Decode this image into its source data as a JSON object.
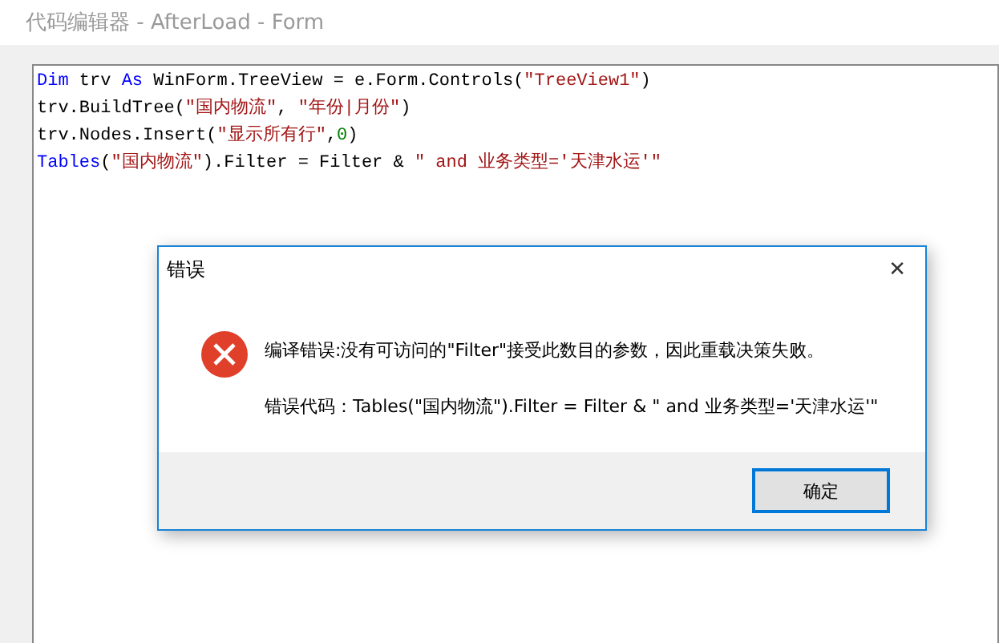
{
  "window": {
    "title": "代码编辑器 - AfterLoad - Form"
  },
  "code_lines": [
    [
      {
        "kind": "keyword",
        "text": "Dim"
      },
      {
        "kind": "plain",
        "text": " trv "
      },
      {
        "kind": "keyword",
        "text": "As"
      },
      {
        "kind": "plain",
        "text": " WinForm.TreeView = e.Form.Controls("
      },
      {
        "kind": "string",
        "text": "\"TreeView1\""
      },
      {
        "kind": "plain",
        "text": ")"
      }
    ],
    [
      {
        "kind": "plain",
        "text": "trv.BuildTree("
      },
      {
        "kind": "string",
        "text": "\"国内物流\""
      },
      {
        "kind": "plain",
        "text": ", "
      },
      {
        "kind": "string",
        "text": "\"年份|月份\""
      },
      {
        "kind": "plain",
        "text": ")"
      }
    ],
    [
      {
        "kind": "plain",
        "text": "trv.Nodes.Insert("
      },
      {
        "kind": "string",
        "text": "\"显示所有行\""
      },
      {
        "kind": "plain",
        "text": ","
      },
      {
        "kind": "number",
        "text": "0"
      },
      {
        "kind": "plain",
        "text": ")"
      }
    ],
    [
      {
        "kind": "keyword",
        "text": "Tables"
      },
      {
        "kind": "plain",
        "text": "("
      },
      {
        "kind": "string",
        "text": "\"国内物流\""
      },
      {
        "kind": "plain",
        "text": ").Filter = Filter & "
      },
      {
        "kind": "string",
        "text": "\" and 业务类型='天津水运'\""
      }
    ]
  ],
  "dialog": {
    "title": "错误",
    "close": "✕",
    "message": "编译错误:没有可访问的\"Filter\"接受此数目的参数，因此重载决策失败。",
    "detail": "错误代码：Tables(\"国内物流\").Filter = Filter & \" and 业务类型='天津水运'\"",
    "button": "确定"
  }
}
